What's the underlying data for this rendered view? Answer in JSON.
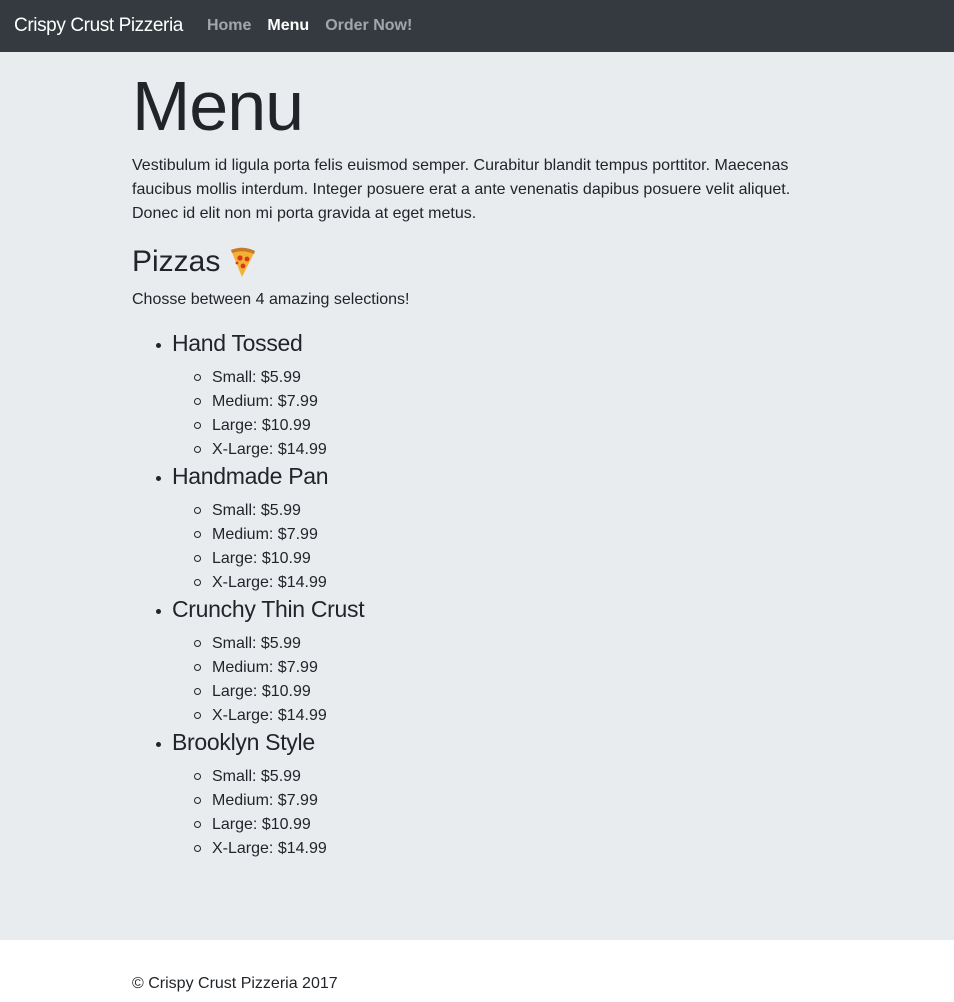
{
  "nav": {
    "brand": "Crispy Crust Pizzeria",
    "links": [
      {
        "label": "Home",
        "active": false
      },
      {
        "label": "Menu",
        "active": true
      },
      {
        "label": "Order Now!",
        "active": false
      }
    ]
  },
  "main": {
    "title": "Menu",
    "lead": "Vestibulum id ligula porta felis euismod semper. Curabitur blandit tempus porttitor. Maecenas faucibus mollis interdum. Integer posuere erat a ante venenatis dapibus posuere velit aliquet. Donec id elit non mi porta gravida at eget metus.",
    "section_title": "Pizzas",
    "section_icon": "pizza-slice-icon",
    "subtitle": "Chosse between 4 amazing selections!",
    "pizzas": [
      {
        "name": "Hand Tossed",
        "sizes": [
          "Small: $5.99",
          "Medium: $7.99",
          "Large: $10.99",
          "X-Large: $14.99"
        ]
      },
      {
        "name": "Handmade Pan",
        "sizes": [
          "Small: $5.99",
          "Medium: $7.99",
          "Large: $10.99",
          "X-Large: $14.99"
        ]
      },
      {
        "name": "Crunchy Thin Crust",
        "sizes": [
          "Small: $5.99",
          "Medium: $7.99",
          "Large: $10.99",
          "X-Large: $14.99"
        ]
      },
      {
        "name": "Brooklyn Style",
        "sizes": [
          "Small: $5.99",
          "Medium: $7.99",
          "Large: $10.99",
          "X-Large: $14.99"
        ]
      }
    ]
  },
  "footer": {
    "text": "© Crispy Crust Pizzeria 2017"
  },
  "colors": {
    "navbar": "#343a40",
    "jumbotron": "#e9ecef",
    "text": "#212529"
  }
}
